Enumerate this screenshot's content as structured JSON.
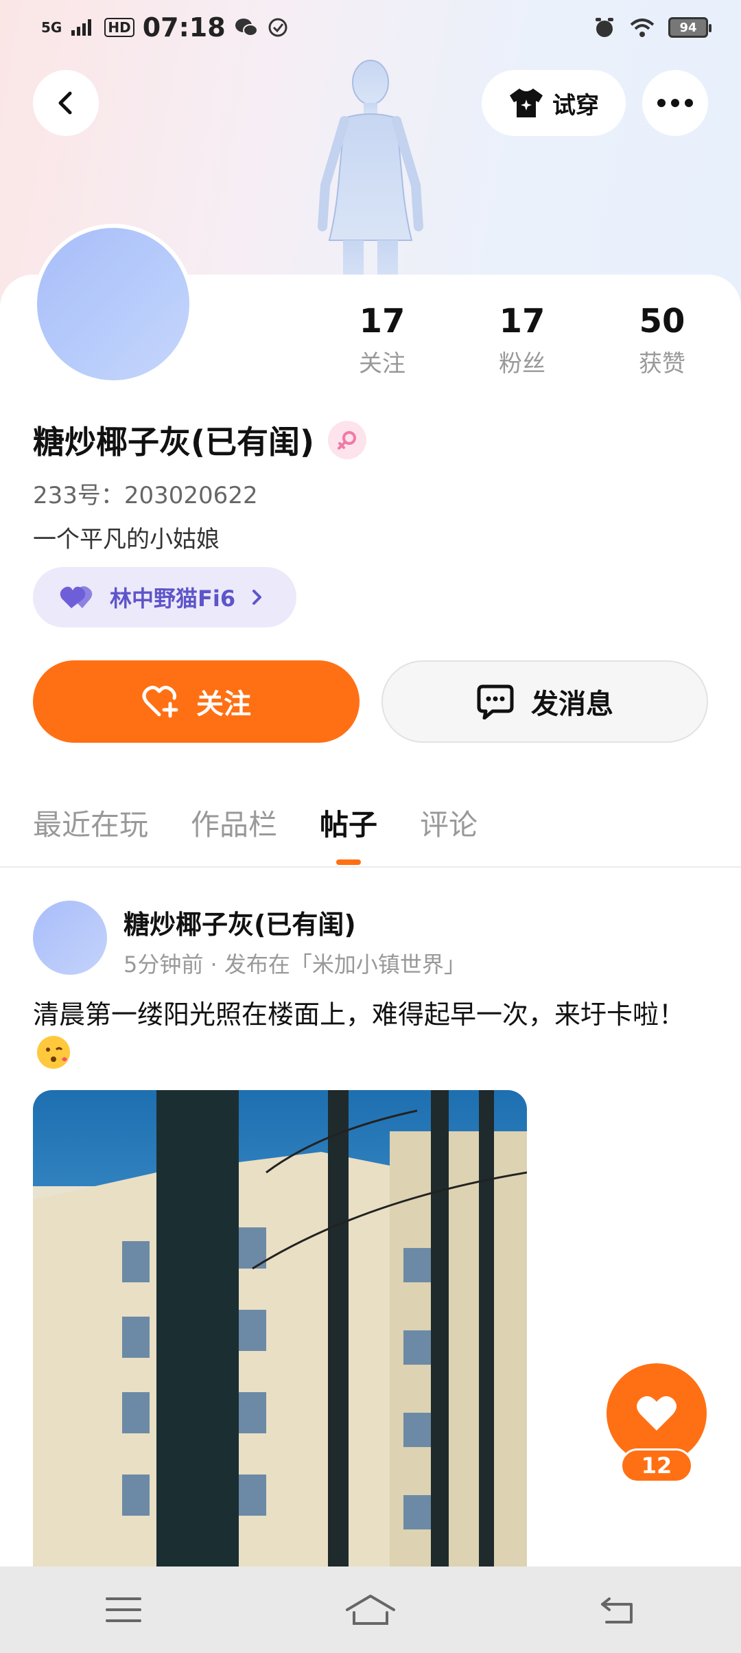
{
  "status_bar": {
    "network": "5G",
    "hd": "HD",
    "time": "07:18",
    "battery": "94"
  },
  "header": {
    "try_on_label": "试穿"
  },
  "profile": {
    "stats": [
      {
        "value": "17",
        "label": "关注"
      },
      {
        "value": "17",
        "label": "粉丝"
      },
      {
        "value": "50",
        "label": "获赞"
      }
    ],
    "name": "糖炒椰子灰(已有闺)",
    "uid": "233号：203020622",
    "bio": "一个平凡的小姑娘",
    "couple_name": "林中野猫Fi6",
    "follow_label": "关注",
    "message_label": "发消息"
  },
  "tabs": [
    {
      "label": "最近在玩",
      "active": false
    },
    {
      "label": "作品栏",
      "active": false
    },
    {
      "label": "帖子",
      "active": true
    },
    {
      "label": "评论",
      "active": false
    }
  ],
  "post": {
    "author": "糖炒椰子灰(已有闺)",
    "meta": "5分钟前 · 发布在「米加小镇世界」",
    "text": "清晨第一缕阳光照在楼面上，难得起早一次，来圩卡啦！",
    "like_count": "12"
  },
  "colors": {
    "accent": "#ff7014",
    "couple_text": "#5e55c9"
  }
}
